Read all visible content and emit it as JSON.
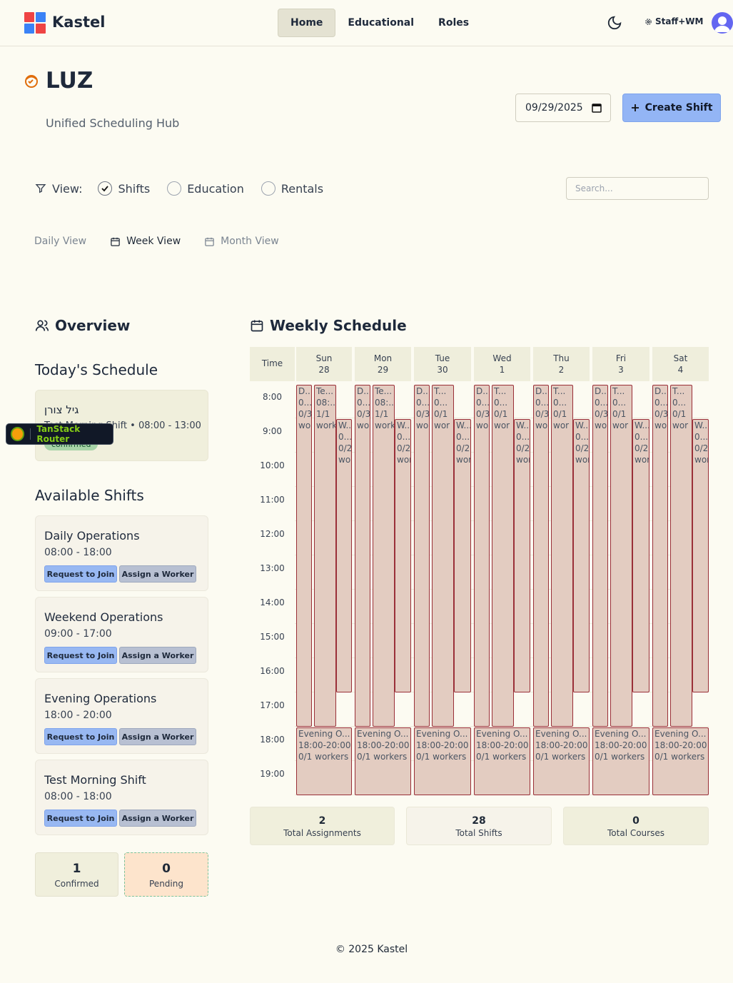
{
  "app": {
    "brand": "Kastel",
    "logo_colors": [
      "#ef4444",
      "#3b82f6",
      "#3b82f6",
      "#ef4444"
    ]
  },
  "nav": {
    "items": [
      "Home",
      "Educational",
      "Roles"
    ],
    "active": "Home"
  },
  "header": {
    "role_label": "Staff+WM"
  },
  "page": {
    "title": "LUZ",
    "subtitle": "Unified Scheduling Hub",
    "date_value": "09/29/2025",
    "create_label": "Create Shift"
  },
  "filters": {
    "view_label": "View:",
    "options": [
      {
        "label": "Shifts",
        "checked": true
      },
      {
        "label": "Education",
        "checked": false
      },
      {
        "label": "Rentals",
        "checked": false
      }
    ],
    "search_placeholder": "Search..."
  },
  "view_tabs": [
    {
      "label": "Daily View",
      "active": false,
      "icon": ""
    },
    {
      "label": "Week View",
      "active": true,
      "icon": "calendar-icon"
    },
    {
      "label": "Month View",
      "active": false,
      "icon": "calendar-icon"
    }
  ],
  "overview": {
    "title": "Overview",
    "today_title": "Today's Schedule",
    "today": {
      "name": "גיל צורן",
      "detail": "Test Morning Shift • 08:00 - 13:00",
      "status": "confirmed"
    },
    "available_title": "Available Shifts",
    "shifts": [
      {
        "name": "Daily Operations",
        "time": "08:00 - 18:00"
      },
      {
        "name": "Weekend Operations",
        "time": "09:00 - 17:00"
      },
      {
        "name": "Evening Operations",
        "time": "18:00 - 20:00"
      },
      {
        "name": "Test Morning Shift",
        "time": "08:00 - 18:00"
      }
    ],
    "request_label": "Request to Join",
    "assign_label": "Assign a Worker",
    "confirmed": {
      "value": "1",
      "label": "Confirmed"
    },
    "pending": {
      "value": "0",
      "label": "Pending"
    }
  },
  "devtools": {
    "label": "TanStack Router"
  },
  "schedule": {
    "title": "Weekly Schedule",
    "time_header": "Time",
    "days": [
      {
        "name": "Sun",
        "date": "28"
      },
      {
        "name": "Mon",
        "date": "29"
      },
      {
        "name": "Tue",
        "date": "30"
      },
      {
        "name": "Wed",
        "date": "1"
      },
      {
        "name": "Thu",
        "date": "2"
      },
      {
        "name": "Fri",
        "date": "3"
      },
      {
        "name": "Sat",
        "date": "4"
      }
    ],
    "times": [
      "8:00",
      "9:00",
      "10:00",
      "11:00",
      "12:00",
      "13:00",
      "14:00",
      "15:00",
      "16:00",
      "17:00",
      "18:00",
      "19:00"
    ],
    "col_a_sun_mon": [
      "D...",
      "0...",
      "0/3",
      "wor"
    ],
    "col_a": [
      "D...",
      "0...",
      "0/3",
      "wor"
    ],
    "col_b_sun_mon": [
      "Te...",
      "08:...",
      "1/1",
      "work"
    ],
    "col_b": [
      "T...",
      "0...",
      "0/1",
      "wor"
    ],
    "col_c": [
      "W...",
      "0...",
      "0/2",
      "wor"
    ],
    "evening": [
      "Evening O...",
      "18:00-20:00",
      "0/1 workers"
    ],
    "stats": [
      {
        "value": "2",
        "label": "Total Assignments"
      },
      {
        "value": "28",
        "label": "Total Shifts"
      },
      {
        "value": "0",
        "label": "Total Courses"
      }
    ]
  },
  "footer": {
    "text": "© 2025 Kastel"
  }
}
